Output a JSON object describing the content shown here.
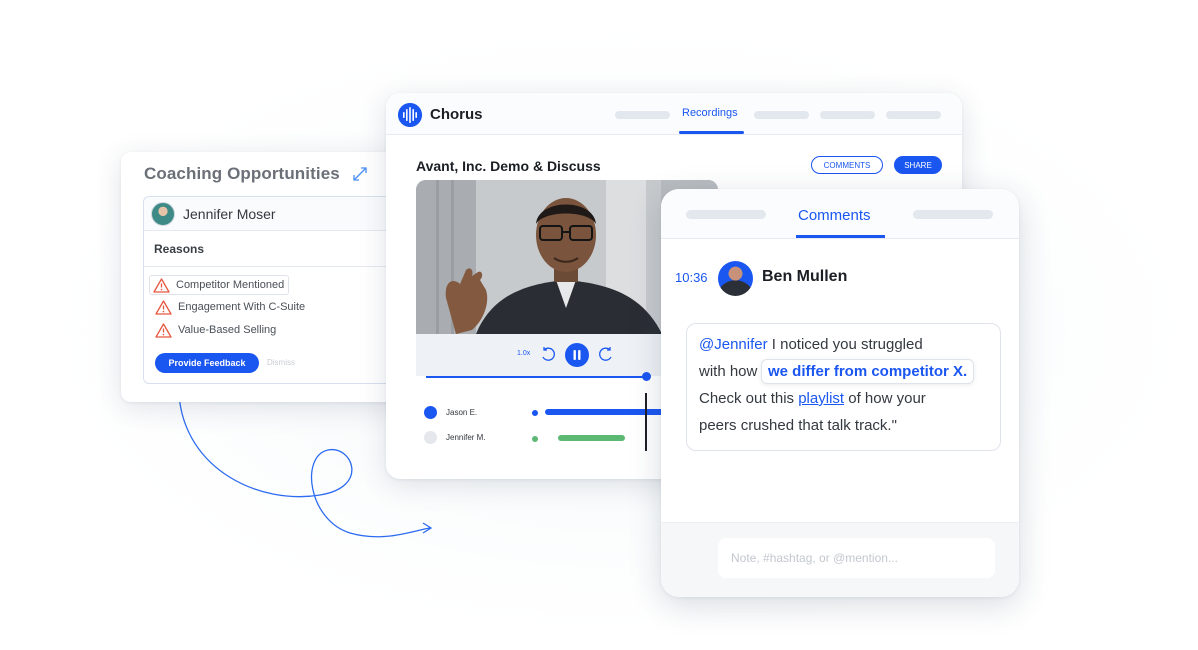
{
  "coaching": {
    "title": "Coaching Opportunities",
    "person": "Jennifer Moser",
    "reasons_heading": "Reasons",
    "reasons": [
      "Competitor Mentioned",
      "Engagement With C-Suite",
      "Value-Based Selling"
    ],
    "feedback_button": "Provide Feedback",
    "dismiss": "Dismiss"
  },
  "chorus": {
    "logo": "Chorus",
    "nav_active": "Recordings",
    "meeting_title": "Avant, Inc. Demo & Discuss",
    "comments_button": "COMMENTS",
    "share_button": "SHARE",
    "playback_speed": "1.0x",
    "playback_progress": 0.92,
    "speakers": [
      {
        "name": "Jason E.",
        "color": "#1a56f0"
      },
      {
        "name": "Jennifer M.",
        "color": "#e4e7ec",
        "track_color": "#5bb974"
      }
    ]
  },
  "comments": {
    "tab": "Comments",
    "time": "10:36",
    "author": "Ben Mullen",
    "mention": "@Jennifer",
    "text_1": " I noticed you struggled",
    "text_2": "with how",
    "highlight": "we differ from competitor X.",
    "text_3": "Check out this",
    "link": "playlist",
    "text_4": " of how your",
    "text_5": "peers crushed that talk track.\"",
    "input_placeholder": "Note, #hashtag, or @mention..."
  },
  "colors": {
    "accent": "#1a56f0",
    "warning": "#e5573f",
    "green": "#5bb974"
  },
  "icons": [
    "expand-icon",
    "warning-icon",
    "chorus-logo-icon",
    "rewind-icon",
    "pause-icon",
    "forward-icon"
  ]
}
